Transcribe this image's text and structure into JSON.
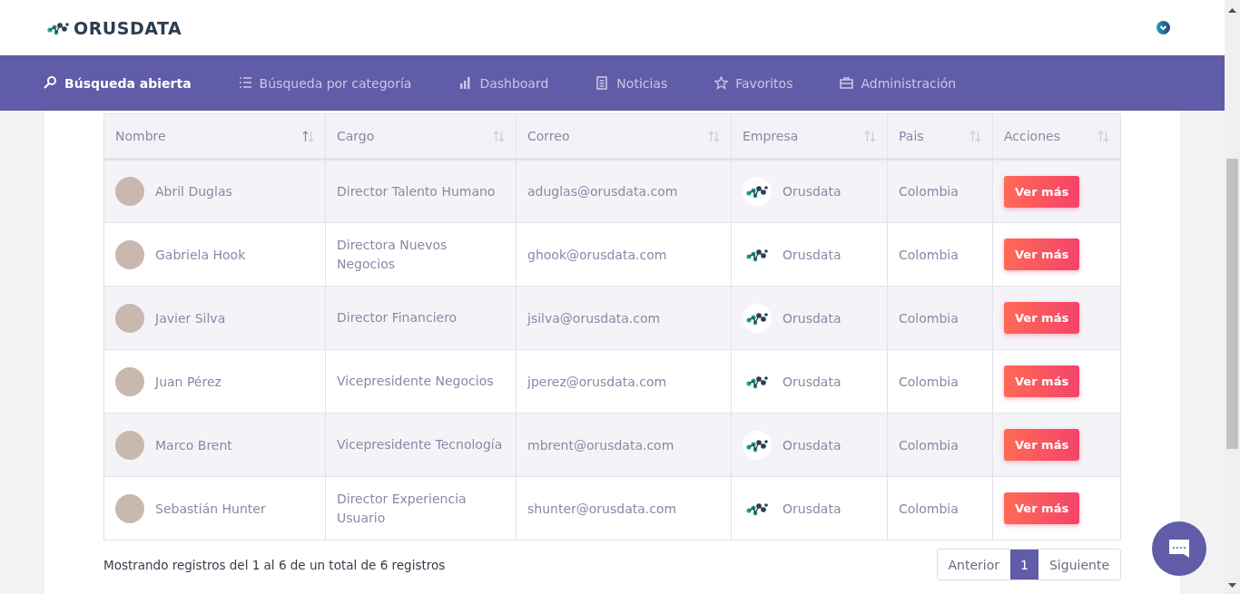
{
  "brand": {
    "name": "ORUSDATA"
  },
  "nav": [
    {
      "label": "Búsqueda abierta",
      "selected": true
    },
    {
      "label": "Búsqueda por categoría",
      "selected": false
    },
    {
      "label": "Dashboard",
      "selected": false
    },
    {
      "label": "Noticias",
      "selected": false
    },
    {
      "label": "Favoritos",
      "selected": false
    },
    {
      "label": "Administración",
      "selected": false
    }
  ],
  "table": {
    "columns": [
      {
        "label": "Nombre",
        "sorted": true
      },
      {
        "label": "Cargo",
        "sorted": false
      },
      {
        "label": "Correo",
        "sorted": false
      },
      {
        "label": "Empresa",
        "sorted": false
      },
      {
        "label": "Pais",
        "sorted": false
      },
      {
        "label": "Acciones",
        "sorted": false
      }
    ],
    "rows": [
      {
        "name": "Abril Duglas",
        "role": "Director Talento Humano",
        "email": "aduglas@orusdata.com",
        "company": "Orusdata",
        "country": "Colombia",
        "action": "Ver más"
      },
      {
        "name": "Gabriela Hook",
        "role": "Directora Nuevos Negocios",
        "email": "ghook@orusdata.com",
        "company": "Orusdata",
        "country": "Colombia",
        "action": "Ver más"
      },
      {
        "name": "Javier Silva",
        "role": "Director Financiero",
        "email": "jsilva@orusdata.com",
        "company": "Orusdata",
        "country": "Colombia",
        "action": "Ver más"
      },
      {
        "name": "Juan Pérez",
        "role": "Vicepresidente Negocios",
        "email": "jperez@orusdata.com",
        "company": "Orusdata",
        "country": "Colombia",
        "action": "Ver más"
      },
      {
        "name": "Marco Brent",
        "role": "Vicepresidente Tecnología",
        "email": "mbrent@orusdata.com",
        "company": "Orusdata",
        "country": "Colombia",
        "action": "Ver más"
      },
      {
        "name": "Sebastián Hunter",
        "role": "Director Experiencia Usuario",
        "email": "shunter@orusdata.com",
        "company": "Orusdata",
        "country": "Colombia",
        "action": "Ver más"
      }
    ]
  },
  "footer": {
    "summary": "Mostrando registros del 1 al 6 de un total de 6 registros"
  },
  "pagination": [
    {
      "label": "Anterior",
      "selected": false
    },
    {
      "label": "1",
      "selected": true
    },
    {
      "label": "Siguiente",
      "selected": false
    }
  ]
}
